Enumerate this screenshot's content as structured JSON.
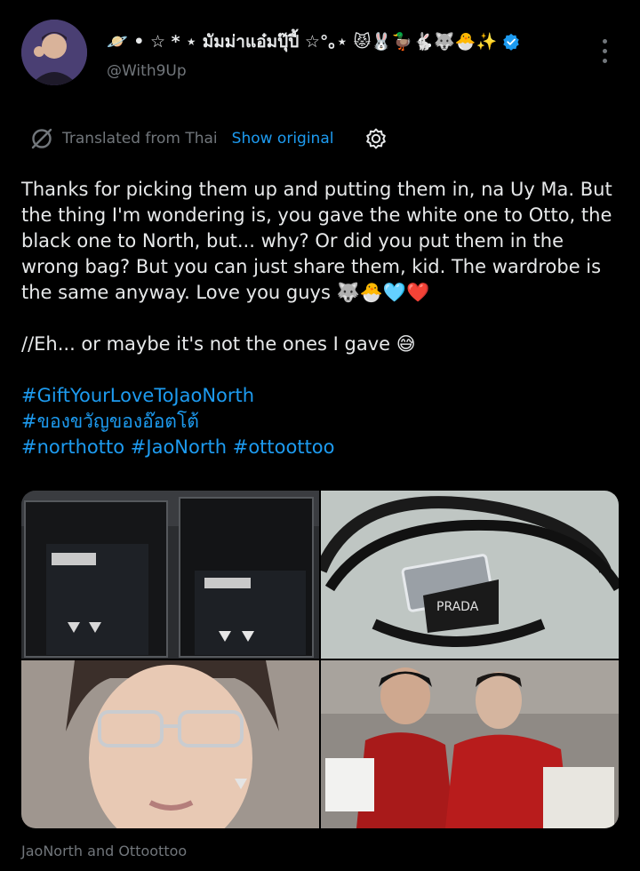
{
  "user": {
    "display_name": "🪐 • ☆ * ⋆ มัมม่าแอ๋มปุ๊ปี้ ☆°｡⋆ 😾🐰🦆🐇🐺🐣✨",
    "handle": "@With9Up"
  },
  "translation": {
    "label": "Translated from Thai",
    "show_original": "Show original"
  },
  "tweet": {
    "paragraph1": "Thanks for picking them up and putting them in, na Uy Ma. But the thing I'm wondering is, you gave the white one to Otto, the black one to North, but... why? Or did you put them in the wrong bag? But you can just share them, kid. The wardrobe is the same anyway. Love you guys 🐺🐣🩵❤️",
    "paragraph2": "//Eh... or maybe it's not the ones I gave 😅",
    "hashtags": [
      "#GiftYourLoveToJaoNorth",
      "#ของขวัญของอ๊อตโต้",
      "#northotto",
      "#JaoNorth",
      "#ottoottoo"
    ]
  },
  "media_caption": "JaoNorth and Ottoottoo",
  "colors": {
    "background": "#000000",
    "text": "#e7e9ea",
    "muted": "#71767b",
    "accent": "#1d9bf0"
  }
}
